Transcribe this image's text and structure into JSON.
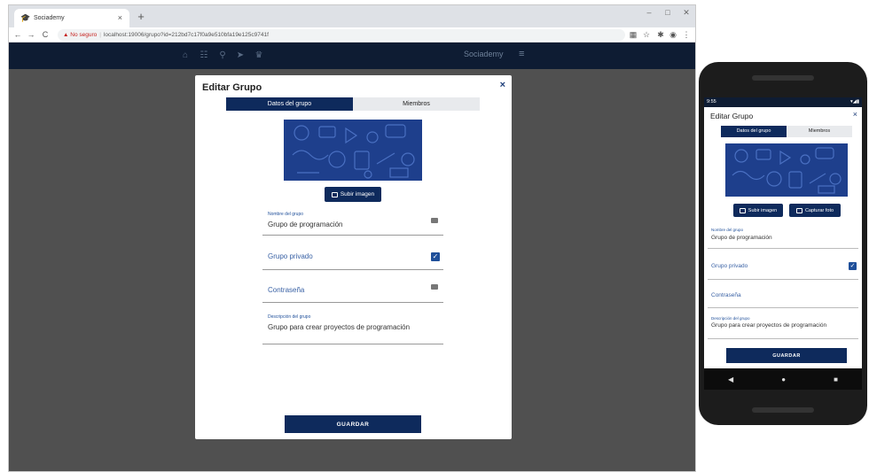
{
  "browser": {
    "tab_title": "Sociademy",
    "tab_close": "×",
    "new_tab": "+",
    "url_warning": "No seguro",
    "url": "localhost:19006/grupo?id=212bd7c17f0a9e510bfa19e125c9741f"
  },
  "app": {
    "brand": "Sociademy"
  },
  "modal": {
    "title": "Editar Grupo",
    "close": "×",
    "tabs": {
      "datos": "Datos del grupo",
      "miembros": "Miembros"
    },
    "upload_button": "Subir imagen",
    "capture_button": "Capturar foto",
    "fields": {
      "nombre_label": "Nombre del grupo",
      "nombre_value": "Grupo de programación",
      "privado_label": "Grupo privado",
      "privado_checked": true,
      "contrasena_placeholder": "Contraseña",
      "descripcion_label": "Descripción del grupo",
      "descripcion_value": "Grupo para crear proyectos de programación"
    },
    "save_button": "GUARDAR"
  },
  "phone": {
    "status_time": "9:55",
    "status_right": "▾◢▮"
  },
  "colors": {
    "nav": "#0e1c33",
    "primary": "#0e2a5c",
    "accent": "#1f4f9a",
    "overlay": "#505050"
  }
}
